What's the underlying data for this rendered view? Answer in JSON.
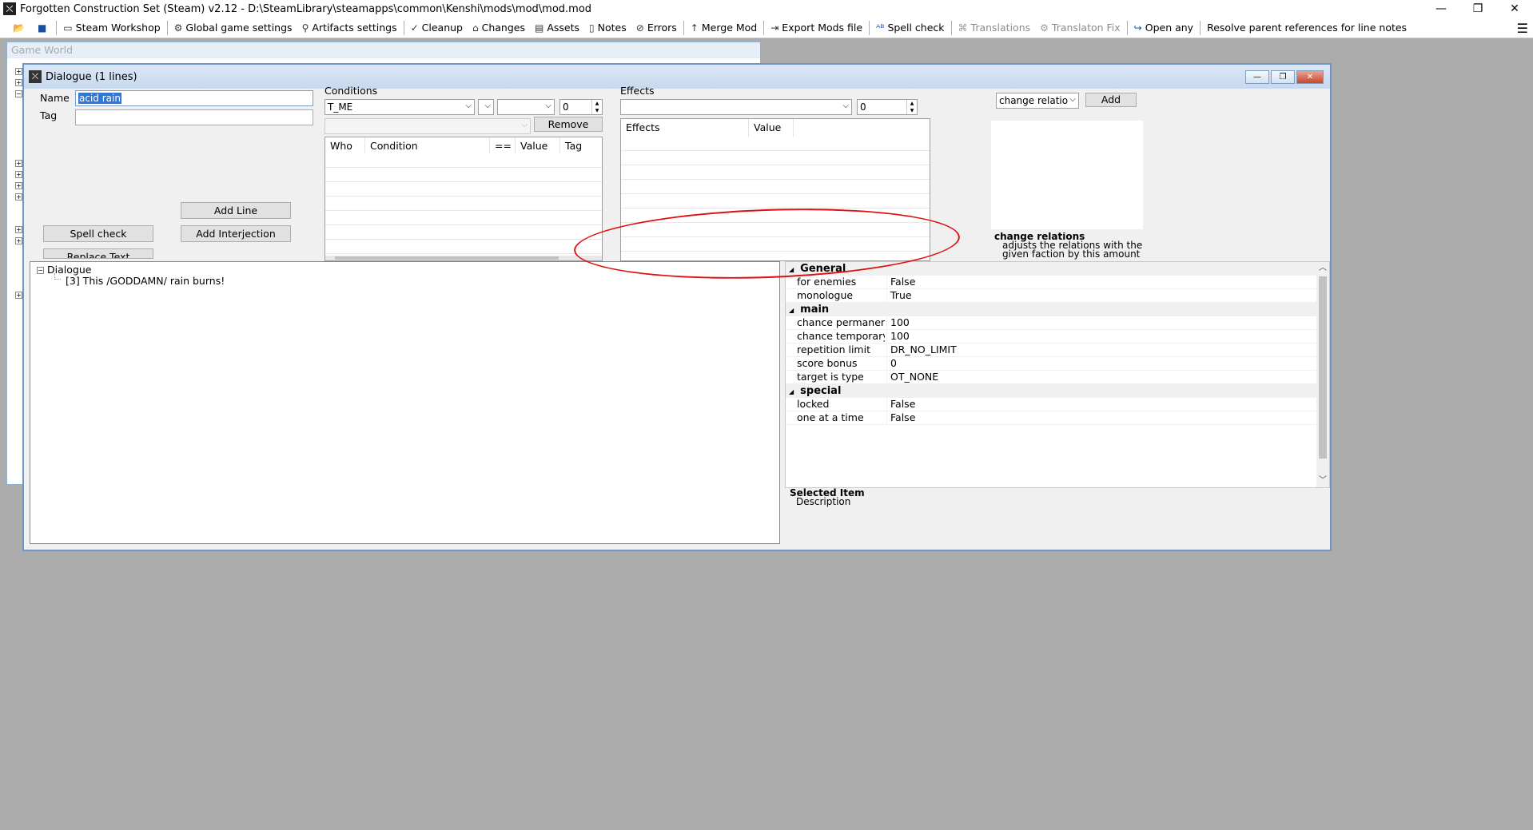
{
  "app": {
    "title": "Forgotten Construction Set (Steam) v2.12 - D:\\SteamLibrary\\steamapps\\common\\Kenshi\\mods\\mod\\mod.mod",
    "icon": "app-logo-icon",
    "win_min": "—",
    "win_max": "❐",
    "win_close": "✕"
  },
  "toolbar": {
    "items": [
      {
        "label": "Steam Workshop",
        "icon": "workshop-icon",
        "glyph": "▭"
      },
      {
        "label": "Global game settings",
        "icon": "gear-icon",
        "glyph": "⚙"
      },
      {
        "label": "Artifacts settings",
        "icon": "artifact-icon",
        "glyph": "⚲"
      },
      {
        "label": "Cleanup",
        "icon": "cleanup-icon",
        "glyph": "✓"
      },
      {
        "label": "Changes",
        "icon": "changes-icon",
        "glyph": "⌂"
      },
      {
        "label": "Assets",
        "icon": "assets-icon",
        "glyph": "▤"
      },
      {
        "label": "Notes",
        "icon": "notes-icon",
        "glyph": "▯"
      },
      {
        "label": "Errors",
        "icon": "errors-icon",
        "glyph": "⊘"
      },
      {
        "label": "Merge Mod",
        "icon": "merge-icon",
        "glyph": "↑"
      },
      {
        "label": "Export Mods file",
        "icon": "export-icon",
        "glyph": "⇥"
      },
      {
        "label": "Spell check",
        "icon": "spellcheck-icon",
        "glyph": "ᴬᴮ"
      },
      {
        "label": "Translations",
        "icon": "translations-icon",
        "glyph": "⌘"
      },
      {
        "label": "Translaton Fix",
        "icon": "translation-fix-icon",
        "glyph": "⚙"
      },
      {
        "label": "Open any",
        "icon": "open-icon",
        "glyph": "↪"
      },
      {
        "label": "Resolve parent references for line notes",
        "icon": "",
        "glyph": ""
      }
    ]
  },
  "gameworld": {
    "title": "Game World"
  },
  "dialogue": {
    "title": "Dialogue (1 lines)",
    "name_label": "Name",
    "name_value": "acid rain",
    "tag_label": "Tag",
    "tag_value": "",
    "add_line": "Add Line",
    "spell_check": "Spell check",
    "add_interjection": "Add Interjection",
    "replace_text": "Replace Text",
    "conditions": {
      "label": "Conditions",
      "who": "T_ME",
      "operator": "",
      "value_combo": "",
      "number": "0",
      "remove": "Remove",
      "columns": [
        "Who",
        "Condition",
        "==",
        "Value",
        "Tag"
      ]
    },
    "effects": {
      "label": "Effects",
      "combo": "",
      "number": "0",
      "columns": [
        "Effects",
        "Value"
      ]
    },
    "action": {
      "combo": "change relatio",
      "add": "Add",
      "desc_title": "change relations",
      "desc_body": "adjusts the relations with the given faction by this amount"
    },
    "tree": {
      "root": "Dialogue",
      "children": [
        "[3] This /GODDAMN/ rain burns!"
      ]
    },
    "properties": {
      "categories": [
        {
          "name": "General",
          "rows": [
            {
              "name": "for enemies",
              "value": "False"
            },
            {
              "name": "monologue",
              "value": "True"
            }
          ]
        },
        {
          "name": "main",
          "rows": [
            {
              "name": "chance permanent",
              "value": "100"
            },
            {
              "name": "chance temporary",
              "value": "100"
            },
            {
              "name": "repetition limit",
              "value": "DR_NO_LIMIT"
            },
            {
              "name": "score bonus",
              "value": "0"
            },
            {
              "name": "target is type",
              "value": "OT_NONE"
            }
          ]
        },
        {
          "name": "special",
          "rows": [
            {
              "name": "locked",
              "value": "False"
            },
            {
              "name": "one at a time",
              "value": "False"
            }
          ]
        }
      ],
      "selected_title": "Selected Item",
      "selected_desc": "Description"
    }
  }
}
